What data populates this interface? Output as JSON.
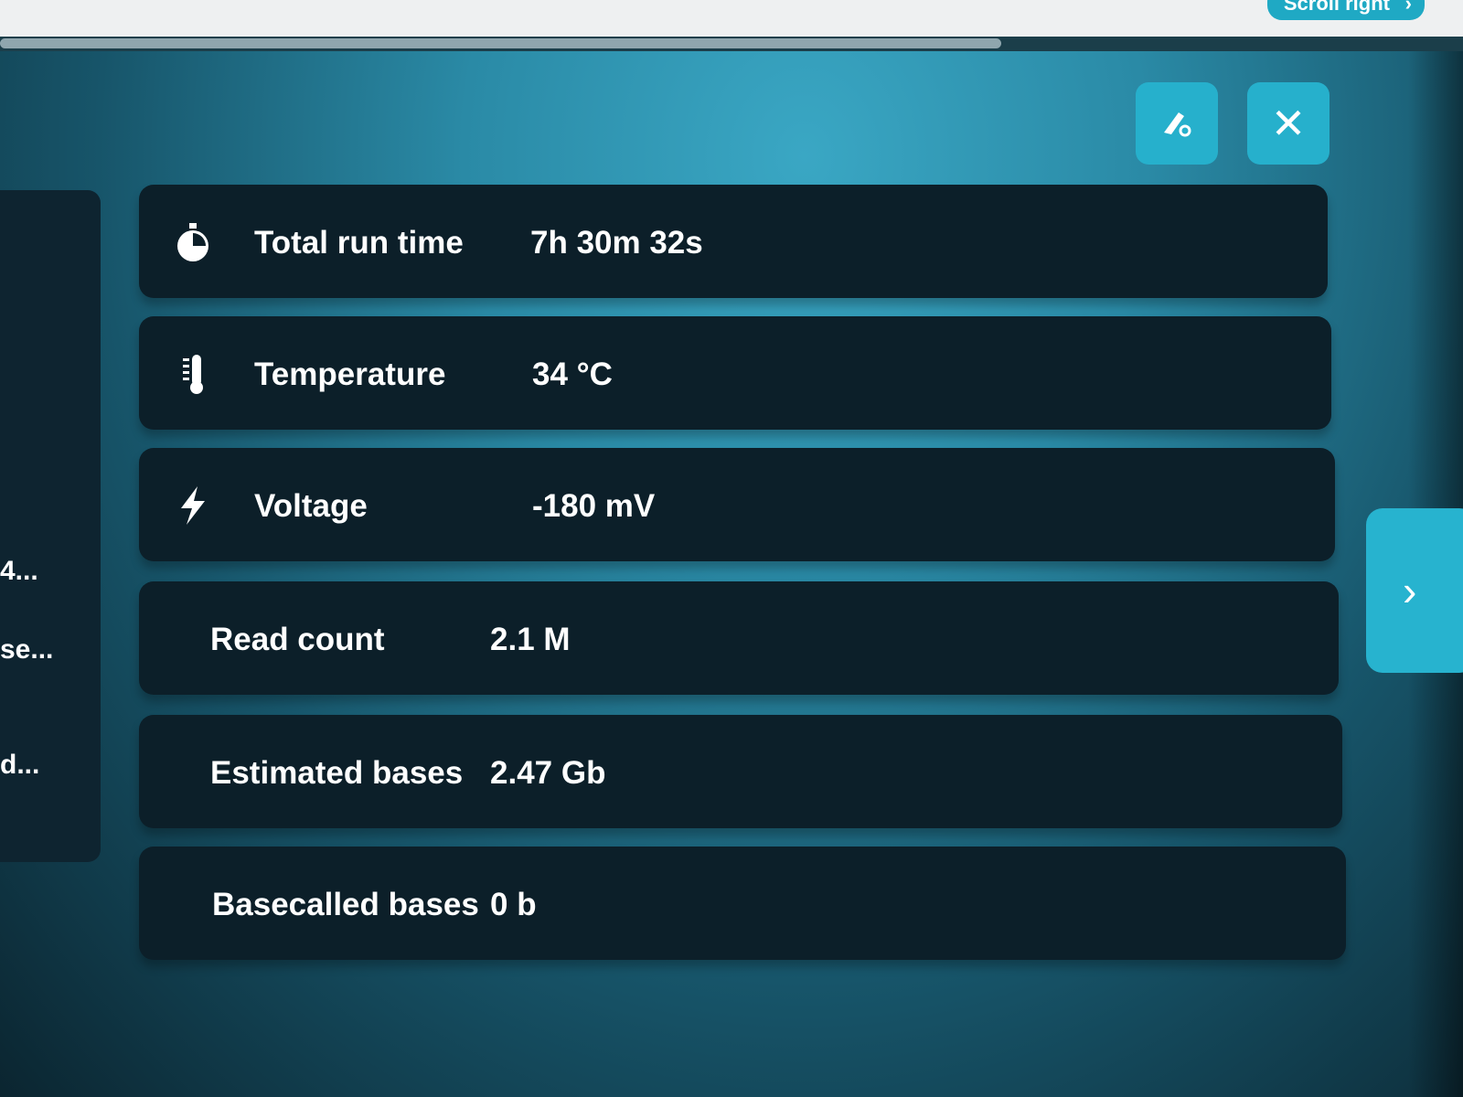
{
  "header": {
    "scroll_right_label": "Scroll right"
  },
  "toolbar": {
    "clear_icon": "eraser-icon",
    "close_icon": "close-icon",
    "close_glyph": "✕"
  },
  "left_panel": {
    "labels": [
      "4...",
      "se...",
      "d..."
    ]
  },
  "navigation": {
    "next_icon": "chevron-right-icon",
    "next_glyph": "›"
  },
  "stats": [
    {
      "label": "Total run time",
      "value": "7h 30m 32s",
      "icon": "stopwatch-icon"
    },
    {
      "label": "Temperature",
      "value": "34 °C",
      "icon": "thermometer-icon"
    },
    {
      "label": "Voltage",
      "value": "-180 mV",
      "icon": "lightning-bolt-icon"
    },
    {
      "label": "Read count",
      "value": "2.1 M"
    },
    {
      "label": "Estimated bases",
      "value": "2.47 Gb"
    },
    {
      "label": "Basecalled bases",
      "value": "0 b"
    }
  ],
  "colors": {
    "accent": "#26b0cc",
    "card_background": "#0c1f29",
    "text": "#ffffff"
  }
}
